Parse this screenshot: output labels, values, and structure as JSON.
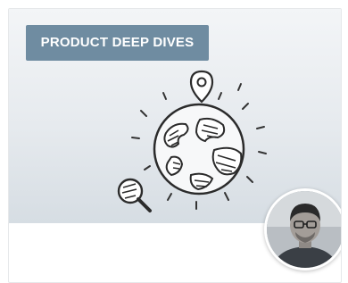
{
  "card": {
    "tag_label": "PRODUCT DEEP DIVES"
  },
  "icons": {
    "illustration": "globe-with-map-pin-and-magnifier-icon",
    "avatar": "person-avatar"
  },
  "colors": {
    "tag_background": "#6f8ca1",
    "hero_top": "#f3f5f7",
    "hero_bottom": "#d6dde3"
  }
}
